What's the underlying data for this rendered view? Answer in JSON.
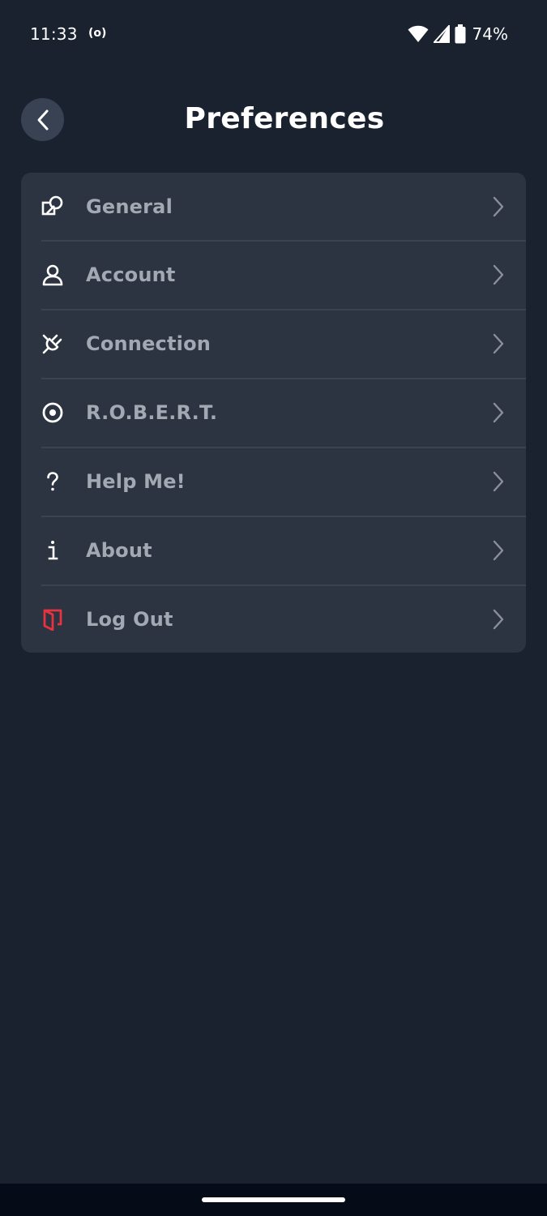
{
  "status_bar": {
    "time": "11:33",
    "cast_indicator": "(o)",
    "battery_percent": "74%",
    "icons": [
      "wifi-icon",
      "signal-icon",
      "battery-icon"
    ]
  },
  "header": {
    "title": "Preferences",
    "back_icon": "chevron-left-icon"
  },
  "menu": {
    "items": [
      {
        "label": "General",
        "icon": "shapes-icon"
      },
      {
        "label": "Account",
        "icon": "person-icon"
      },
      {
        "label": "Connection",
        "icon": "plug-icon"
      },
      {
        "label": "R.O.B.E.R.T.",
        "icon": "robot-eye-icon"
      },
      {
        "label": "Help Me!",
        "icon": "question-icon"
      },
      {
        "label": "About",
        "icon": "info-icon"
      },
      {
        "label": "Log Out",
        "icon": "logout-door-icon"
      }
    ],
    "chevron_icon": "chevron-right-icon"
  },
  "colors": {
    "background": "#1a2230",
    "card": "#2c3341",
    "label": "#a3a9b3",
    "logout_accent": "#e53340",
    "back_button": "#394252"
  }
}
